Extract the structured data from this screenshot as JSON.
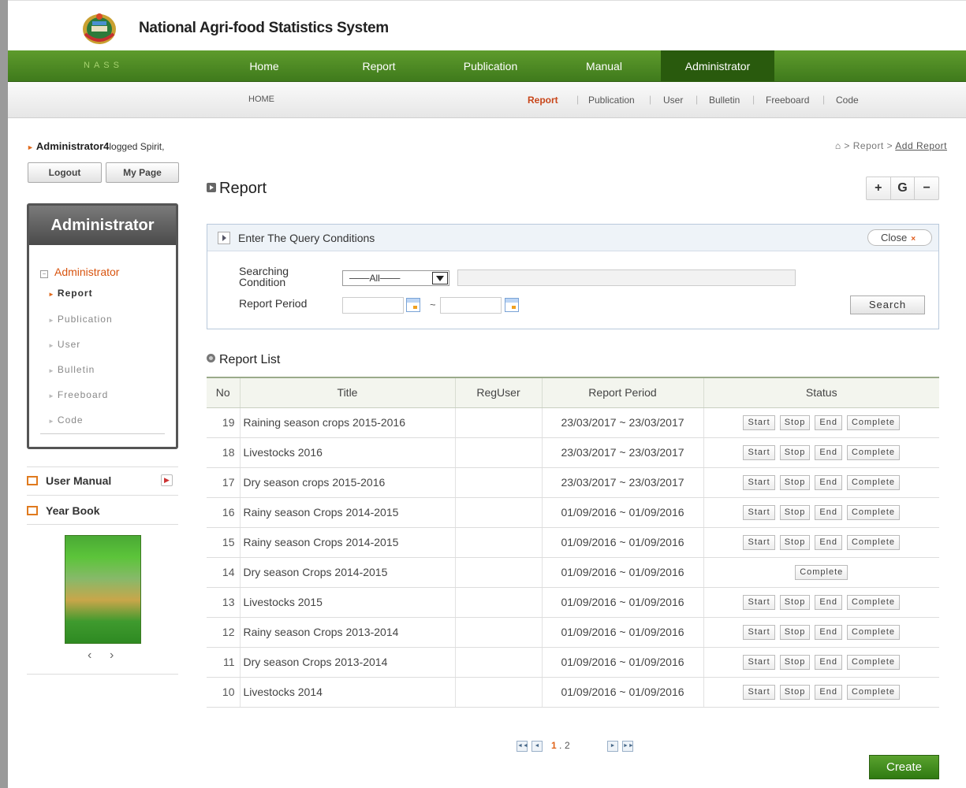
{
  "site": {
    "title": "National Agri-food Statistics System",
    "brand": "NASS"
  },
  "main_nav": [
    "Home",
    "Report",
    "Publication",
    "Manual",
    "Administrator"
  ],
  "sub_nav": {
    "home": "HOME",
    "items": [
      "Report",
      "Publication",
      "User",
      "Bulletin",
      "Freeboard",
      "Code"
    ]
  },
  "sidebar": {
    "login_user": "Administrator4",
    "login_suffix": "logged Spirit,",
    "logout": "Logout",
    "my_page": "My Page",
    "admin_box_title": "Administrator",
    "admin_section": "Administrator",
    "admin_menu": [
      "Report",
      "Publication",
      "User",
      "Bulletin",
      "Freeboard",
      "Code"
    ],
    "user_manual": "User Manual",
    "year_book": "Year Book"
  },
  "breadcrumb": {
    "items": [
      "Report",
      "Add Report"
    ]
  },
  "page_title": "Report",
  "zoom": {
    "plus": "+",
    "reset": "G",
    "minus": "−"
  },
  "query": {
    "title": "Enter The Query Conditions",
    "close": "Close",
    "searching_condition_label": "Searching Condition",
    "select_value": "───All───",
    "report_period_label": "Report Period",
    "search": "Search"
  },
  "list_title": "Report List",
  "table": {
    "columns": [
      "No",
      "Title",
      "RegUser",
      "Report Period",
      "Status"
    ],
    "rows": [
      {
        "no": "19",
        "title": "Raining season crops 2015-2016",
        "reguser": "",
        "period": "23/03/2017 ~ 23/03/2017",
        "status": [
          "Start",
          "Stop",
          "End",
          "Complete"
        ]
      },
      {
        "no": "18",
        "title": "Livestocks 2016",
        "reguser": "",
        "period": "23/03/2017 ~ 23/03/2017",
        "status": [
          "Start",
          "Stop",
          "End",
          "Complete"
        ]
      },
      {
        "no": "17",
        "title": "Dry season crops 2015-2016",
        "reguser": "",
        "period": "23/03/2017 ~ 23/03/2017",
        "status": [
          "Start",
          "Stop",
          "End",
          "Complete"
        ]
      },
      {
        "no": "16",
        "title": "Rainy season Crops 2014-2015",
        "reguser": "",
        "period": "01/09/2016 ~ 01/09/2016",
        "status": [
          "Start",
          "Stop",
          "End",
          "Complete"
        ]
      },
      {
        "no": "15",
        "title": "Rainy season Crops 2014-2015",
        "reguser": "",
        "period": "01/09/2016 ~ 01/09/2016",
        "status": [
          "Start",
          "Stop",
          "End",
          "Complete"
        ]
      },
      {
        "no": "14",
        "title": "Dry season Crops 2014-2015",
        "reguser": "",
        "period": "01/09/2016 ~ 01/09/2016",
        "status": [
          "Complete"
        ]
      },
      {
        "no": "13",
        "title": "Livestocks 2015",
        "reguser": "",
        "period": "01/09/2016 ~ 01/09/2016",
        "status": [
          "Start",
          "Stop",
          "End",
          "Complete"
        ]
      },
      {
        "no": "12",
        "title": "Rainy season Crops 2013-2014",
        "reguser": "",
        "period": "01/09/2016 ~ 01/09/2016",
        "status": [
          "Start",
          "Stop",
          "End",
          "Complete"
        ]
      },
      {
        "no": "11",
        "title": "Dry season Crops 2013-2014",
        "reguser": "",
        "period": "01/09/2016 ~ 01/09/2016",
        "status": [
          "Start",
          "Stop",
          "End",
          "Complete"
        ]
      },
      {
        "no": "10",
        "title": "Livestocks 2014",
        "reguser": "",
        "period": "01/09/2016 ~ 01/09/2016",
        "status": [
          "Start",
          "Stop",
          "End",
          "Complete"
        ]
      }
    ]
  },
  "pagination": {
    "pages": [
      "1",
      "2"
    ],
    "current": "1",
    "separator": "."
  },
  "create": "Create"
}
